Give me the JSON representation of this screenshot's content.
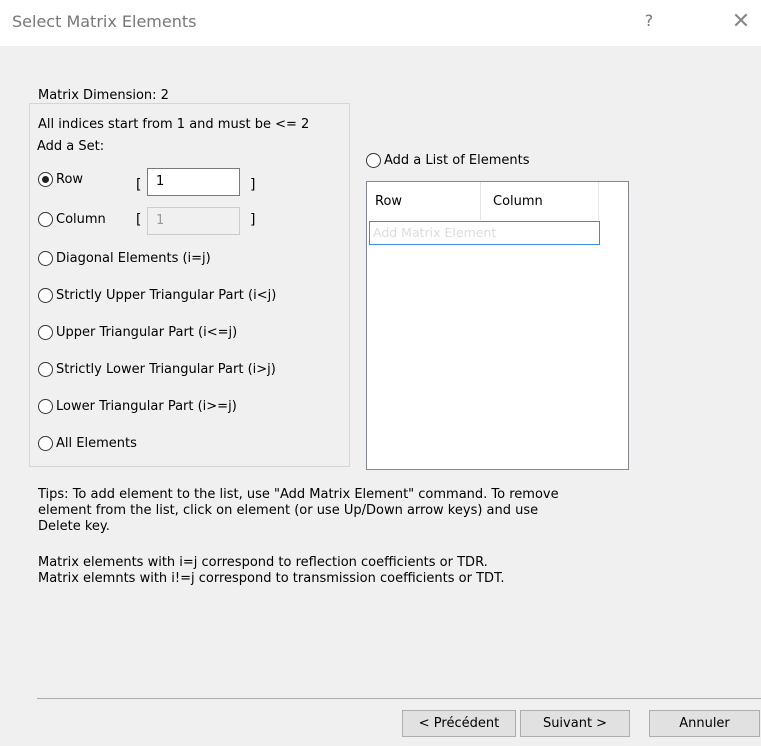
{
  "window": {
    "title": "Select Matrix Elements",
    "help": "?",
    "close": "✕"
  },
  "info": {
    "dimension": "Matrix Dimension: 2",
    "indices": "All indices start from 1 and must be <= 2"
  },
  "add_set": {
    "title": "Add a Set:",
    "row_label": "Row",
    "row_value": "1",
    "column_label": "Column",
    "column_value": "1",
    "options": [
      "Diagonal Elements (i=j)",
      "Strictly Upper Triangular Part (i<j)",
      "Upper Triangular Part (i<=j)",
      "Strictly Lower Triangular Part (i>j)",
      "Lower Triangular Part (i>=j)",
      "All Elements"
    ],
    "bracket_open": "[",
    "bracket_close": "]"
  },
  "list": {
    "radio_label": "Add a List of Elements",
    "columns": [
      "Row",
      "Column"
    ],
    "add_placeholder": "Add Matrix Element"
  },
  "tips": {
    "line1": "Tips: To add element to the list, use \"Add Matrix Element\" command. To remove",
    "line2": "element from the list, click on element (or use Up/Down arrow keys) and use",
    "line3": "Delete key.",
    "line4": "Matrix elements with i=j correspond to reflection coefficients or TDR.",
    "line5": "Matrix elemnts with i!=j correspond to transmission coefficients or TDT."
  },
  "buttons": {
    "back": "< Précédent",
    "next": "Suivant >",
    "cancel": "Annuler"
  },
  "selected_option": "Row"
}
